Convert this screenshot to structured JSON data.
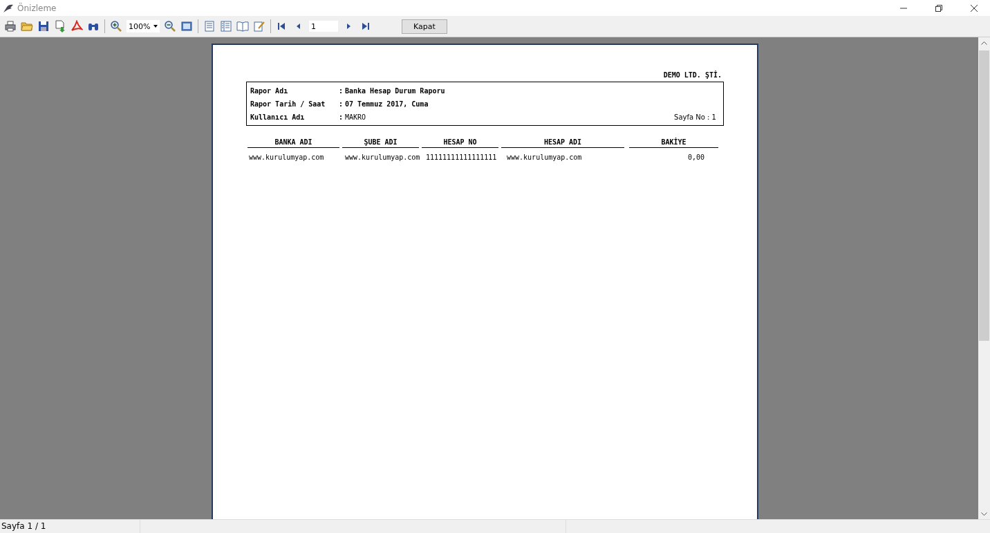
{
  "window": {
    "title": "Önizleme"
  },
  "toolbar": {
    "zoom": "100%",
    "page": "1",
    "close_button": "Kapat"
  },
  "report": {
    "company": "DEMO LTD. ŞTİ.",
    "info": [
      {
        "label": "Rapor Adı",
        "separator": ":",
        "value": "Banka Hesap Durum Raporu",
        "bold": true
      },
      {
        "label": "Rapor Tarih / Saat",
        "separator": ":",
        "value": "07 Temmuz 2017, Cuma",
        "bold": true
      },
      {
        "label": "Kullanıcı Adı",
        "separator": ":",
        "value": "MAKRO",
        "bold": false
      }
    ],
    "page_no": "Sayfa No : 1",
    "columns": [
      "BANKA ADI",
      "ŞUBE ADI",
      "HESAP NO",
      "HESAP ADI",
      "BAKİYE"
    ],
    "rows": [
      [
        "www.kurulumyap.com",
        "www.kurulumyap.com",
        "11111111111111111",
        "www.kurulumyap.com",
        "0,00"
      ]
    ]
  },
  "status_bar": [
    "Sayfa 1 / 1"
  ]
}
